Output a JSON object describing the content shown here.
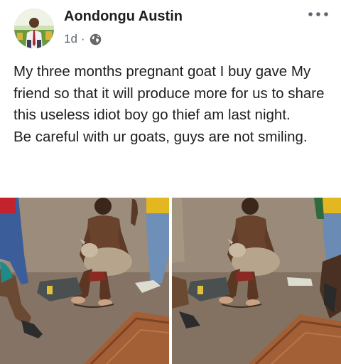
{
  "post": {
    "author_name": "Aondongu Austin",
    "timestamp": "1d",
    "separator": "·",
    "privacy_icon": "globe-icon",
    "more_icon": "more-horizontal-icon",
    "text": "My three months pregnant goat I buy gave My friend so that it will produce more for us to share this useless idiot boy go thief am last night.\nBe careful with ur goats, guys are not smiling."
  },
  "photos": [
    {
      "name": "photo-1",
      "subject": "young man sitting on floor holding a goat"
    },
    {
      "name": "photo-2",
      "subject": "young man sitting on floor holding a goat"
    }
  ],
  "colors": {
    "text_primary": "#1c1e21",
    "text_secondary": "#606770",
    "background": "#ffffff"
  }
}
